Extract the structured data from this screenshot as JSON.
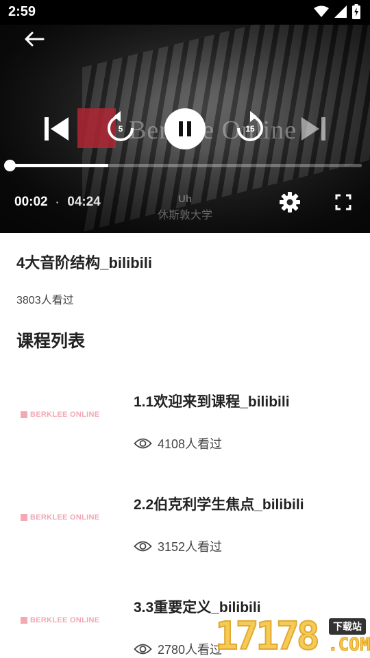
{
  "status_bar": {
    "time": "2:59"
  },
  "player": {
    "logo_text": "Berklee Online",
    "subtitle_en": "Uh",
    "subtitle_cn": "休斯敦大学",
    "current_time": "00:02",
    "separator": "·",
    "total_time": "04:24",
    "progress_fraction": 0.28,
    "rewind_seconds": "5",
    "forward_seconds": "15"
  },
  "video": {
    "title": "4大音阶结构_bilibili",
    "views": "3803人看过"
  },
  "section": {
    "title": "课程列表"
  },
  "courses": [
    {
      "thumb_text": "BERKLEE ONLINE",
      "title": "1.1欢迎来到课程_bilibili",
      "views": "4108人看过"
    },
    {
      "thumb_text": "BERKLEE ONLINE",
      "title": "2.2伯克利学生焦点_bilibili",
      "views": "3152人看过"
    },
    {
      "thumb_text": "BERKLEE ONLINE",
      "title": "3.3重要定义_bilibili",
      "views": "2780人看过"
    }
  ],
  "watermark": {
    "digits": "17178",
    "badge": "下载站",
    "suffix": ".COM"
  },
  "colors": {
    "accent_pink": "#f3a8b2",
    "watermark_gold": "#f5c74a"
  }
}
